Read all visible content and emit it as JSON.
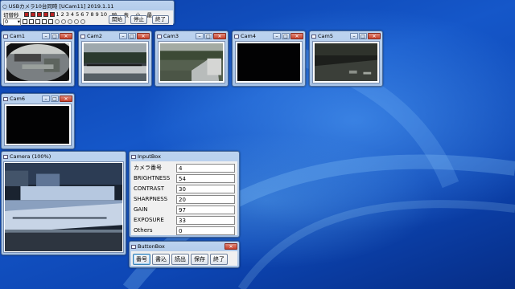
{
  "main_window": {
    "title": "○ USBカメラ10台同時 [UCam11] 2019.1.11",
    "row1": {
      "label_left": "切替秒",
      "numbers": [
        "1",
        "2",
        "3",
        "4",
        "5",
        "6",
        "7",
        "8",
        "9",
        "10"
      ],
      "labels_right": [
        "暗",
        "表",
        "小",
        "最"
      ]
    },
    "row2": {
      "select_value": "0",
      "open_button": "開始",
      "stop_button": "停止",
      "exit_button": "終了"
    }
  },
  "cameras": [
    {
      "title": "Cam1"
    },
    {
      "title": "Cam2"
    },
    {
      "title": "Cam3"
    },
    {
      "title": "Cam4"
    },
    {
      "title": "Cam5"
    },
    {
      "title": "Cam6"
    }
  ],
  "camera_large": {
    "title": "Camera (100%)"
  },
  "input_box": {
    "title": "InputBox",
    "rows": [
      {
        "label": "カメラ番号",
        "value": "4"
      },
      {
        "label": "BRIGHTNESS",
        "value": "54"
      },
      {
        "label": "CONTRAST",
        "value": "30"
      },
      {
        "label": "SHARPNESS",
        "value": "20"
      },
      {
        "label": "GAIN",
        "value": "97"
      },
      {
        "label": "EXPOSURE",
        "value": "33"
      },
      {
        "label": "Others",
        "value": "0"
      }
    ]
  },
  "button_box": {
    "title": "ButtonBox",
    "buttons": [
      "番号",
      "書込",
      "読出",
      "保存",
      "終了"
    ]
  },
  "colors": {
    "desktop": "#1557c9",
    "window_frame": "#a6c1e4",
    "close_button": "#c8402b"
  }
}
